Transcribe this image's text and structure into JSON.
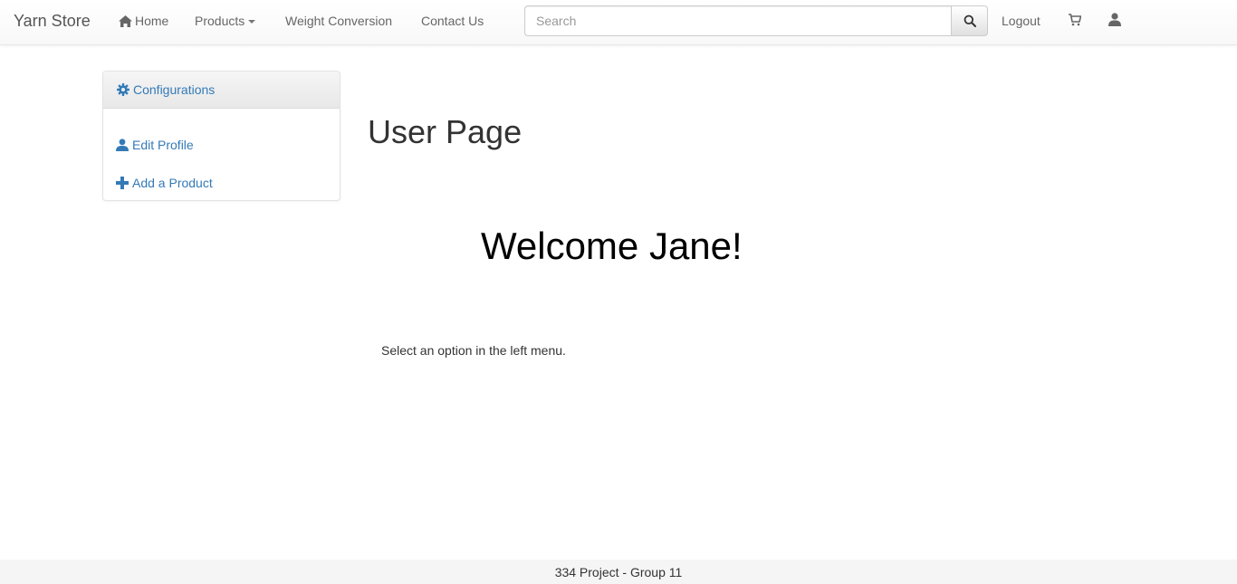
{
  "navbar": {
    "brand": "Yarn Store",
    "home_label": "Home",
    "products_label": "Products",
    "weight_label": "Weight Conversion",
    "contact_label": "Contact Us",
    "search_placeholder": "Search",
    "search_value": "",
    "logout_label": "Logout",
    "icons": {
      "home": "home-icon",
      "caret": "chevron-down-icon",
      "search": "search-icon",
      "cart": "shopping-cart-icon",
      "user": "user-icon"
    }
  },
  "sidebar": {
    "heading": "Configurations",
    "heading_icon": "gear-icon",
    "items": [
      {
        "label": "Edit Profile",
        "icon": "user-icon"
      },
      {
        "label": "Add a Product",
        "icon": "plus-icon"
      }
    ]
  },
  "main": {
    "title": "User Page",
    "welcome": "Welcome Jane!",
    "hint": "Select an option in the left menu."
  },
  "footer": {
    "text": "334 Project - Group 11"
  },
  "colors": {
    "link": "#337ab7",
    "nav_text": "#666666",
    "footer_bg": "#f5f5f5"
  }
}
